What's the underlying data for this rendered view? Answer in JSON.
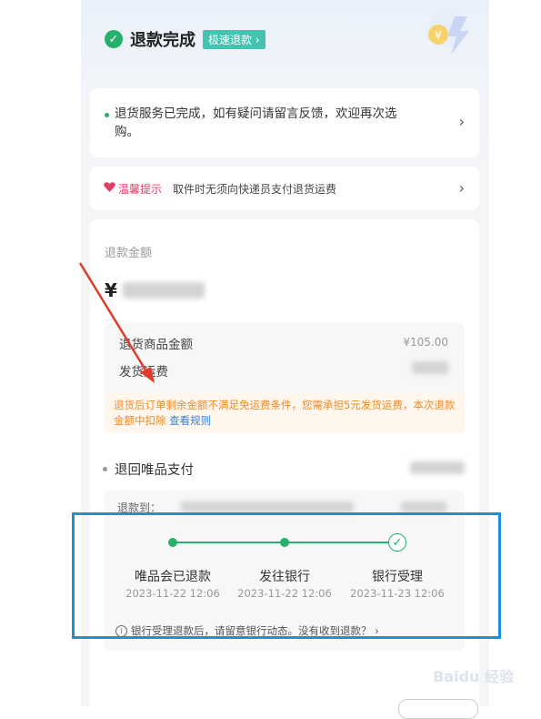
{
  "header": {
    "title": "退款完成",
    "fast_badge": "极速退款 ›"
  },
  "notice": {
    "text": "退货服务已完成，如有疑问请留言反馈，欢迎再次选购。",
    "chevron": "›"
  },
  "tip": {
    "label": "温馨提示",
    "text": "取件时无须向快递员支付退货运费",
    "chevron": "›"
  },
  "refund": {
    "label": "退款金额",
    "currency_symbol": "¥",
    "details": [
      {
        "label": "退货商品金额",
        "value": "¥105.00"
      },
      {
        "label": "发货运费",
        "value": ""
      }
    ],
    "warning_text": "退货后订单剩余金额不满足免运费条件，您需承担5元发货运费，本次退款金额中扣除",
    "warning_link": "查看规则"
  },
  "refund_method": {
    "label": "退回唯品支付"
  },
  "progress": {
    "head": "退款到：",
    "steps": [
      {
        "label": "唯品会已退款",
        "date": "2023-11-22 12:06"
      },
      {
        "label": "发往银行",
        "date": "2023-11-22 12:06"
      },
      {
        "label": "银行受理",
        "date": "2023-11-23 12:06"
      }
    ],
    "bank_tip": "银行受理退款后，请留意银行动态。没有收到退款？ ›"
  },
  "watermark": "Baidu 经验",
  "colors": {
    "green": "#27b06b",
    "teal_badge": "#43c3b0",
    "warning": "#f08a24",
    "link": "#3b7dd8",
    "tip_pink": "#e2406a",
    "highlight_border": "#1e8fd8",
    "arrow": "#e03c2b"
  },
  "icons": [
    "check-circle-icon",
    "lightning-coin-icon",
    "heart-icon",
    "chevron-right-icon",
    "info-icon",
    "red-arrow-annotation"
  ]
}
